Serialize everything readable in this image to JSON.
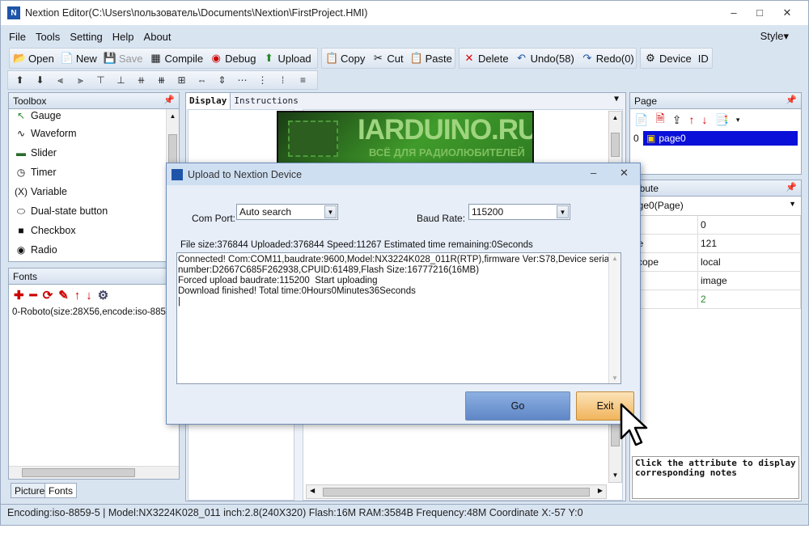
{
  "window": {
    "title": "Nextion Editor(C:\\Users\\пользователь\\Documents\\Nextion\\FirstProject.HMI)",
    "min": "–",
    "max": "□",
    "close": "✕"
  },
  "menu": [
    "File",
    "Tools",
    "Setting",
    "Help",
    "About"
  ],
  "style_menu": "Style▾",
  "toolbar1": [
    {
      "label": "Open",
      "icon": "📂"
    },
    {
      "label": "New",
      "icon": "📄"
    },
    {
      "label": "Save",
      "icon": "💾"
    },
    {
      "label": "Compile",
      "icon": "▦"
    },
    {
      "label": "Debug",
      "icon": "◉"
    },
    {
      "label": "Upload",
      "icon": "⬆"
    }
  ],
  "toolbar2": [
    {
      "label": "Copy",
      "icon": "📋"
    },
    {
      "label": "Cut",
      "icon": "✂"
    },
    {
      "label": "Paste",
      "icon": "📋"
    }
  ],
  "toolbar3": [
    {
      "label": "Delete",
      "icon": "✕"
    },
    {
      "label": "Undo(58)",
      "icon": "↶"
    },
    {
      "label": "Redo(0)",
      "icon": "↷"
    }
  ],
  "toolbar4": [
    {
      "label": "Device",
      "icon": "⚙"
    },
    {
      "label": "ID",
      "icon": ""
    }
  ],
  "toolbox": {
    "title": "Toolbox",
    "items": [
      {
        "label": "Gauge",
        "icon": "↖"
      },
      {
        "label": "Waveform",
        "icon": "∿"
      },
      {
        "label": "Slider",
        "icon": "▬"
      },
      {
        "label": "Timer",
        "icon": "◷"
      },
      {
        "label": "Variable",
        "icon": "(X)"
      },
      {
        "label": "Dual-state button",
        "icon": "⬭"
      },
      {
        "label": "Checkbox",
        "icon": "■"
      },
      {
        "label": "Radio",
        "icon": "◉"
      }
    ]
  },
  "fonts": {
    "title": "Fonts",
    "entry": "0-Roboto(size:28X56,encode:iso-8859-5"
  },
  "bottom_tabs": {
    "picture": "Picture",
    "fonts": "Fonts"
  },
  "display_tabs": {
    "display": "Display",
    "instructions": "Instructions"
  },
  "banner": {
    "title": "IARDUINO.RU",
    "subtitle": "ВСЁ ДЛЯ РАДИОЛЮБИТЕЛЕЙ"
  },
  "page_panel": {
    "title": "Page",
    "index": "0",
    "page_name": "page0"
  },
  "attribute": {
    "title": "ribute",
    "selector": "age0(Page)",
    "rows": [
      {
        "k": "",
        "v": "0"
      },
      {
        "k": "pe",
        "v": "121"
      },
      {
        "k": "scope",
        "v": "local"
      },
      {
        "k": "a",
        "v": "image"
      },
      {
        "k": "c",
        "v": "2"
      }
    ],
    "note": "Click the attribute to display corresponding notes"
  },
  "dialog": {
    "title": "Upload to Nextion Device",
    "com_port_label": "Com Port:",
    "com_port_value": "Auto search",
    "baud_label": "Baud Rate:",
    "baud_value": "115200",
    "progress": "File size:376844 Uploaded:376844 Speed:11267 Estimated time remaining:0Seconds",
    "log": [
      "Connected! Com:COM11,baudrate:9600,Model:NX3224K028_011R(RTP),firmware Ver:S78,Device serial number:D2667C685F262938,CPUID:61489,Flash Size:16777216(16MB)",
      "Forced upload baudrate:115200  Start uploading",
      "Download finished! Total time:0Hours0Minutes36Seconds"
    ],
    "go": "Go",
    "exit": "Exit",
    "min": "–",
    "close": "✕"
  },
  "status": "Encoding:iso-8859-5 | Model:NX3224K028_011  inch:2.8(240X320) Flash:16M RAM:3584B Frequency:48M    Coordinate X:-57  Y:0"
}
